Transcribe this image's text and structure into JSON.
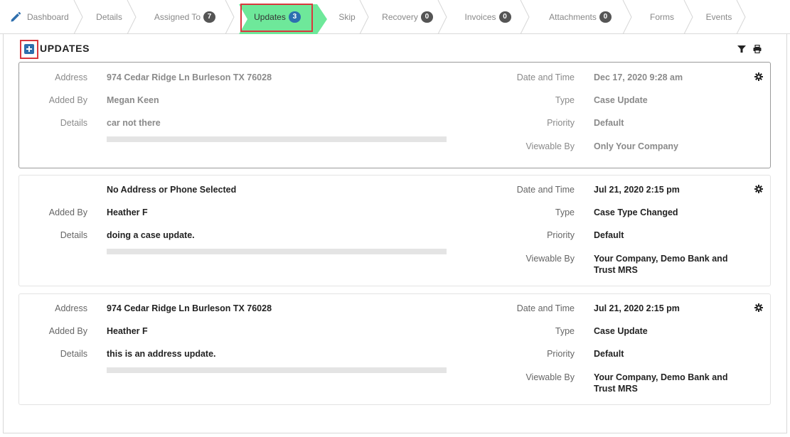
{
  "tabs": [
    {
      "label": "Dashboard",
      "badge": null
    },
    {
      "label": "Details",
      "badge": null
    },
    {
      "label": "Assigned To",
      "badge": "7"
    },
    {
      "label": "Updates",
      "badge": "3"
    },
    {
      "label": "Skip",
      "badge": null
    },
    {
      "label": "Recovery",
      "badge": "0"
    },
    {
      "label": "Invoices",
      "badge": "0"
    },
    {
      "label": "Attachments",
      "badge": "0"
    },
    {
      "label": "Forms",
      "badge": null
    },
    {
      "label": "Events",
      "badge": null
    }
  ],
  "section": {
    "title": "UPDATES"
  },
  "labels": {
    "address": "Address",
    "added_by": "Added By",
    "details": "Details",
    "date_time": "Date and Time",
    "type": "Type",
    "priority": "Priority",
    "viewable_by": "Viewable By"
  },
  "updates": [
    {
      "address": "974 Cedar Ridge Ln Burleson TX 76028",
      "added_by": "Megan Keen",
      "details": "car not there",
      "date_time": "Dec 17, 2020 9:28 am",
      "type": "Case Update",
      "priority": "Default",
      "viewable_by": "Only Your Company"
    },
    {
      "address": "No Address or Phone Selected",
      "added_by": "Heather F",
      "details": "doing a case update.",
      "date_time": "Jul 21, 2020 2:15 pm",
      "type": "Case Type Changed",
      "priority": "Default",
      "viewable_by": "Your Company, Demo Bank and Trust MRS"
    },
    {
      "address": "974 Cedar Ridge Ln Burleson TX 76028",
      "added_by": "Heather F",
      "details": "this is an address update.",
      "date_time": "Jul 21, 2020 2:15 pm",
      "type": "Case Update",
      "priority": "Default",
      "viewable_by": "Your Company, Demo Bank and Trust MRS"
    }
  ],
  "colors": {
    "active_tab": "#6ee89a",
    "highlight": "#d9383e",
    "badge_active": "#2d6fb0"
  }
}
